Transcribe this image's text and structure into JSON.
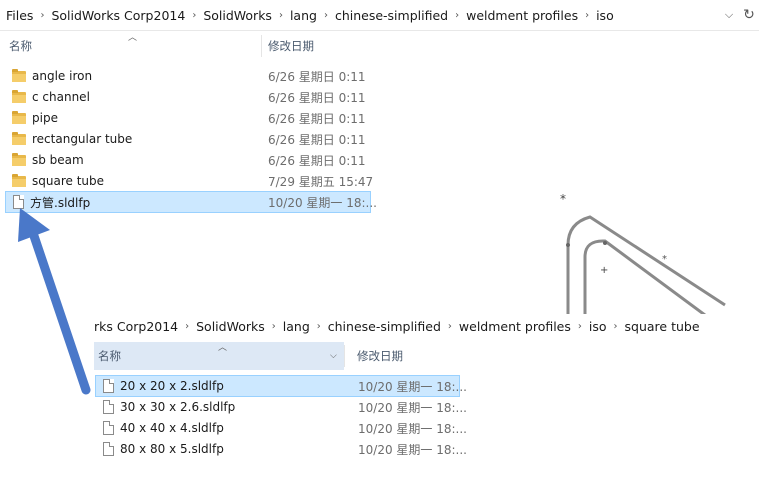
{
  "window1": {
    "breadcrumb": [
      "Files",
      "SolidWorks Corp2014",
      "SolidWorks",
      "lang",
      "chinese-simplified",
      "weldment profiles",
      "iso"
    ],
    "col_name": "名称",
    "col_date": "修改日期",
    "items": [
      {
        "name": "angle iron",
        "date": "6/26 星期日 0:11",
        "type": "folder"
      },
      {
        "name": "c channel",
        "date": "6/26 星期日 0:11",
        "type": "folder"
      },
      {
        "name": "pipe",
        "date": "6/26 星期日 0:11",
        "type": "folder"
      },
      {
        "name": "rectangular tube",
        "date": "6/26 星期日 0:11",
        "type": "folder"
      },
      {
        "name": "sb beam",
        "date": "6/26 星期日 0:11",
        "type": "folder"
      },
      {
        "name": "square tube",
        "date": "7/29 星期五 15:47",
        "type": "folder"
      },
      {
        "name": "方管.sldlfp",
        "date": "10/20 星期一 18:...",
        "type": "file"
      }
    ]
  },
  "window2": {
    "breadcrumb": [
      "rks Corp2014",
      "SolidWorks",
      "lang",
      "chinese-simplified",
      "weldment profiles",
      "iso",
      "square tube"
    ],
    "col_name": "名称",
    "col_date": "修改日期",
    "items": [
      {
        "name": "20 x 20 x 2.sldlfp",
        "date": "10/20 星期一 18:..."
      },
      {
        "name": "30 x 30 x 2.6.sldlfp",
        "date": "10/20 星期一 18:..."
      },
      {
        "name": "40 x 40 x 4.sldlfp",
        "date": "10/20 星期一 18:..."
      },
      {
        "name": "80 x 80 x 5.sldlfp",
        "date": "10/20 星期一 18:..."
      }
    ]
  },
  "colors": {
    "selection": "#cce8ff",
    "arrow": "#4a78c9",
    "folder": "#e8b84a"
  }
}
